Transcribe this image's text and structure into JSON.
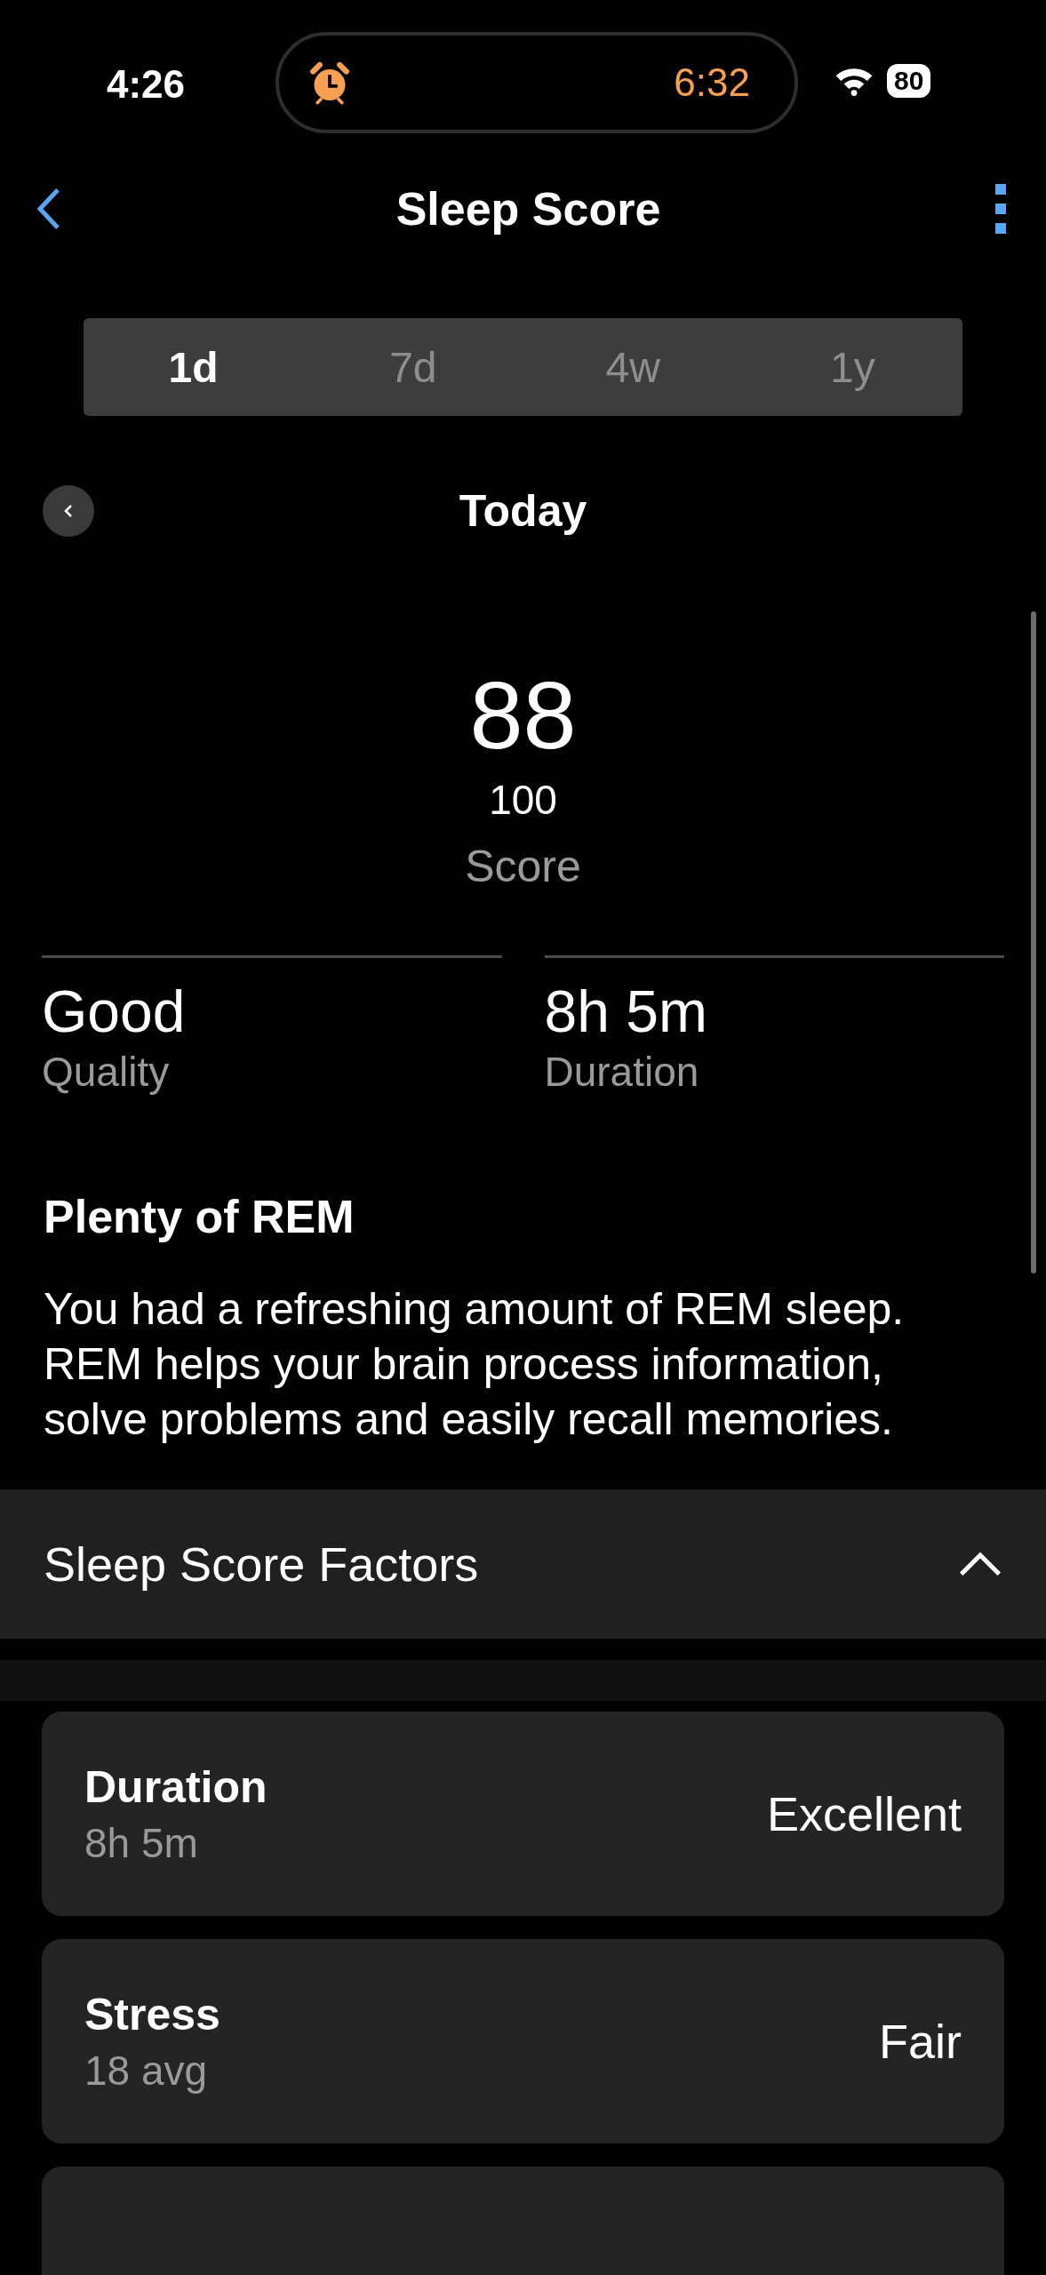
{
  "status_bar": {
    "time": "4:26",
    "alarm_time": "6:32",
    "battery": "80"
  },
  "nav": {
    "title": "Sleep Score"
  },
  "tabs": [
    {
      "label": "1d",
      "selected": true
    },
    {
      "label": "7d",
      "selected": false
    },
    {
      "label": "4w",
      "selected": false
    },
    {
      "label": "1y",
      "selected": false
    }
  ],
  "date_label": "Today",
  "score": {
    "value": "88",
    "max": "100",
    "label": "Score"
  },
  "stats": [
    {
      "value": "Good",
      "label": "Quality"
    },
    {
      "value": "8h 5m",
      "label": "Duration"
    }
  ],
  "insight": {
    "title": "Plenty of REM",
    "text": "You had a refreshing amount of REM sleep. REM helps your brain process information, solve problems and easily recall memories."
  },
  "factors": {
    "title": "Sleep Score Factors",
    "expanded": true,
    "items": [
      {
        "name": "Duration",
        "detail": "8h 5m",
        "rating": "Excellent"
      },
      {
        "name": "Stress",
        "detail": "18 avg",
        "rating": "Fair"
      }
    ]
  }
}
